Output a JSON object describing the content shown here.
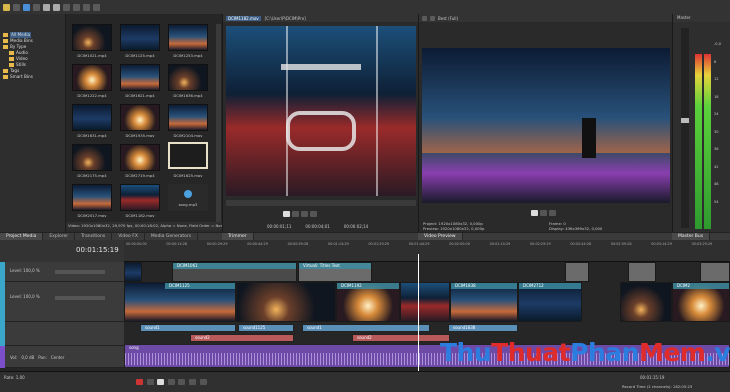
{
  "top_toolbar": {
    "icons": [
      "new-icon",
      "open-icon",
      "save-icon",
      "render-icon",
      "undo-icon",
      "redo-icon",
      "cut-icon",
      "copy-icon",
      "paste-icon",
      "delete-icon"
    ]
  },
  "media_tree": {
    "items": [
      "All Media",
      "Media Bins",
      "By Type",
      "Audio",
      "Video",
      "Stills",
      "Tags",
      "Smart Bins"
    ]
  },
  "media_bin": {
    "thumbs": [
      "DCIM1021.mp4",
      "DCIM1125.mp4",
      "DCIM1253.mp4",
      "DCIM1222.mp4",
      "DCIM1621.mp4",
      "DCIM1636.mp4",
      "DCIM1631.mp4",
      "DCIM1935.mov",
      "DCIM2104.mov",
      "DCIM2175.mp4",
      "DCIM2719.mp4",
      "DCIM1625.mov",
      "DCIM2017.mov",
      "DCIM1182.mov",
      "song.mp3"
    ],
    "info": "Video: 1920x1080x32, 29,970 fps, 00:00:18:02, Alpha = None, Field Order = None"
  },
  "left_tabs": [
    "Project Media",
    "Explorer",
    "Transitions",
    "Video FX",
    "Media Generators"
  ],
  "trimmer": {
    "title": "DCIM1182.mov",
    "path": "[C:\\User\\P\\DCIM\\Pro]",
    "time_in": "00:00:01;11",
    "time_out": "00:00:04;01",
    "time_len": "00:00:02;14",
    "tab": "Trimmer"
  },
  "preview": {
    "quality": "Best (Full)",
    "project": "Project:",
    "project_val": "1920x1080x32, 0,000p",
    "preview_lbl": "Preview:",
    "preview_val": "1920x1080x32, 0,000p",
    "frame_lbl": "Frame:",
    "frame_val": "0",
    "display_lbl": "Display:",
    "display_val": "436x369x32, 0,000",
    "tab": "Video Preview"
  },
  "master": {
    "title": "Master",
    "tab": "Master Bus",
    "scale": [
      "-0,0",
      "-6,1",
      "6",
      "12",
      "18",
      "24",
      "30",
      "36",
      "42",
      "48",
      "54"
    ]
  },
  "timeline": {
    "timecode": "00:01:15:19",
    "ruler": [
      "00:00:00:00",
      "00:00:14:28",
      "00:00:29:29",
      "00:00:44:29",
      "00:00:59:28",
      "00:01:14:29",
      "00:01:29:29",
      "00:01:44:29",
      "00:02:00:00",
      "00:02:14:29",
      "00:02:29:29",
      "00:02:44:28",
      "00:02:59:28",
      "00:03:14:29",
      "00:03:29:29"
    ],
    "track1_level": "Level: 100,0 %",
    "track2_level": "Level: 100,0 %",
    "clip_labels": {
      "v1a": "DCIM1061",
      "v1b": "Virtuali: Titles Text",
      "v2a": "DCIM1125",
      "v2b": "DCIM1192",
      "v2c": "DCIM1838",
      "v2d": "DCIM2712",
      "v2e": "DCIM2",
      "a1a": "sound1",
      "a1b": "sound1125",
      "a1c": "sound1",
      "a1d": "sound1838",
      "a2a": "sound2",
      "a2b": "sound2",
      "song": "song"
    },
    "audio_vol": "Vol:",
    "audio_db": "0,0 dB",
    "pan": "Pan:",
    "center": "Center",
    "rate": "Rate: 1,00",
    "transport_time": "00:01:15:19",
    "record_time": "Record Time (2 channels): 182:05:25"
  },
  "watermark": {
    "thu": "Thu",
    "thuat": "Thuat",
    "phan": "Phan",
    "mem": "Mem",
    ".vn": ".vn"
  },
  "colors": {
    "accent": "#3aa7c9",
    "watermark_blue": "#2b7de0",
    "watermark_red": "#e02b2b"
  }
}
